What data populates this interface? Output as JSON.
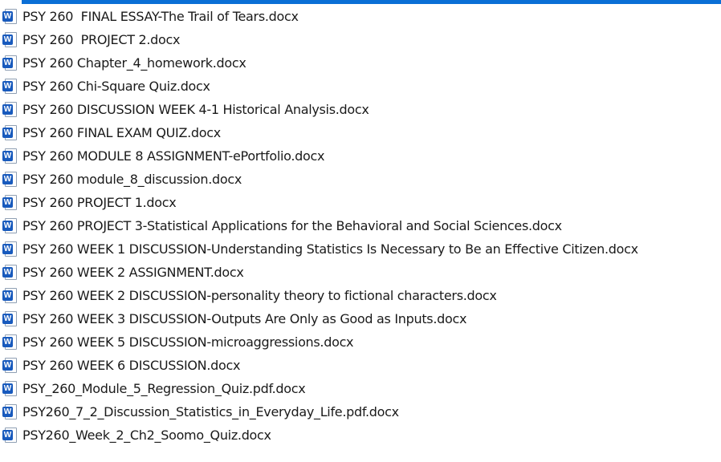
{
  "theme": {
    "accent": "#0a6fd6",
    "word_icon_color": "#185abd",
    "text_color": "#1a1a1a"
  },
  "file_icon": {
    "name": "word-document-icon",
    "badge_letter": "W"
  },
  "files": [
    "PSY 260  FINAL ESSAY-The Trail of Tears.docx",
    "PSY 260  PROJECT 2.docx",
    "PSY 260 Chapter_4_homework.docx",
    "PSY 260 Chi-Square Quiz.docx",
    "PSY 260 DISCUSSION WEEK 4-1 Historical Analysis.docx",
    "PSY 260 FINAL EXAM QUIZ.docx",
    "PSY 260 MODULE 8 ASSIGNMENT-ePortfolio.docx",
    "PSY 260 module_8_discussion.docx",
    "PSY 260 PROJECT 1.docx",
    "PSY 260 PROJECT 3-Statistical Applications for the Behavioral and Social Sciences.docx",
    "PSY 260 WEEK 1 DISCUSSION-Understanding Statistics Is Necessary to Be an Effective Citizen.docx",
    "PSY 260 WEEK 2 ASSIGNMENT.docx",
    "PSY 260 WEEK 2 DISCUSSION-personality theory to fictional characters.docx",
    "PSY 260 WEEK 3 DISCUSSION-Outputs Are Only as Good as Inputs.docx",
    "PSY 260 WEEK 5 DISCUSSION-microaggressions.docx",
    "PSY 260 WEEK 6 DISCUSSION.docx",
    "PSY_260_Module_5_Regression_Quiz.pdf.docx",
    "PSY260_7_2_Discussion_Statistics_in_Everyday_Life.pdf.docx",
    "PSY260_Week_2_Ch2_Soomo_Quiz.docx"
  ]
}
